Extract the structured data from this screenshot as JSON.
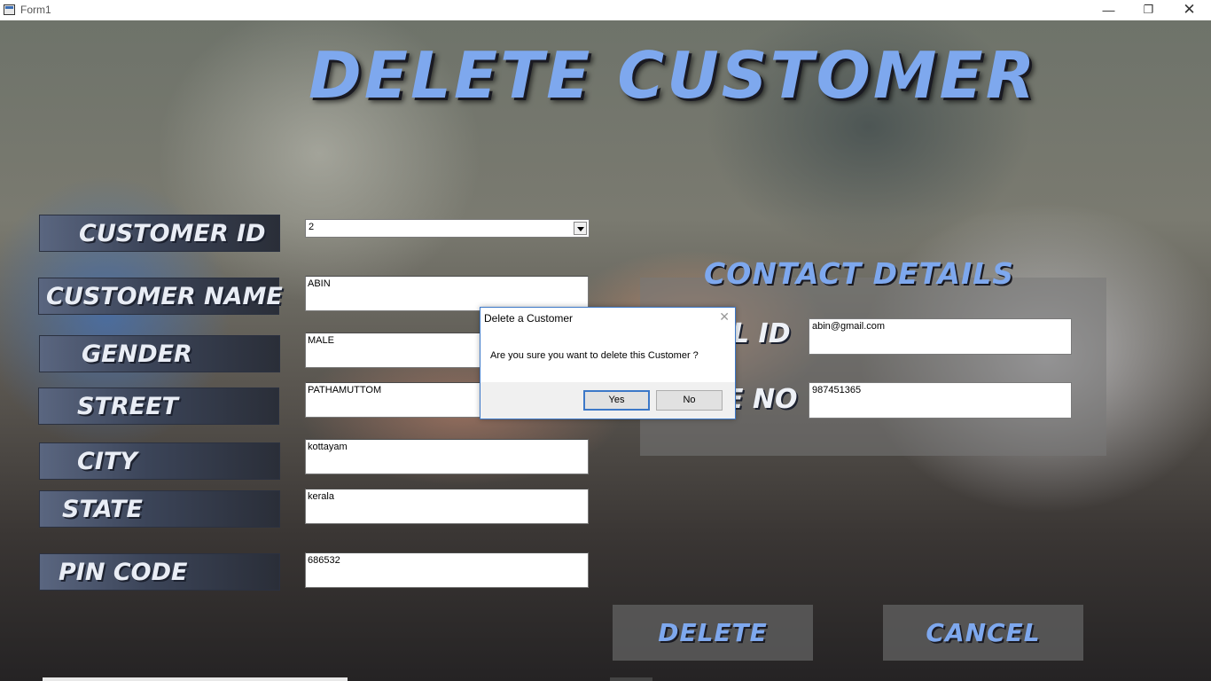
{
  "window": {
    "title": "Form1",
    "minimize": "—",
    "maximize": "❐",
    "close": "✕"
  },
  "form": {
    "heading": "DELETE CUSTOMER",
    "labels": {
      "customer_id": "CUSTOMER ID",
      "customer_name": "CUSTOMER NAME",
      "gender": "GENDER",
      "street": "STREET",
      "city": "CITY",
      "state": "STATE",
      "pin_code": "PIN CODE"
    },
    "values": {
      "customer_id": "2",
      "customer_name": "ABIN",
      "gender": "MALE",
      "street": "PATHAMUTTOM",
      "city": "kottayam",
      "state": "kerala",
      "pin_code": "686532"
    }
  },
  "contact": {
    "heading": "CONTACT DETAILS",
    "email_label_visible": "L ID",
    "phone_label_visible": "E NO",
    "email": "abin@gmail.com",
    "phone": "987451365"
  },
  "buttons": {
    "delete": "DELETE",
    "cancel": "CANCEL"
  },
  "dialog": {
    "title": "Delete a Customer",
    "message": "Are you sure you want to delete this Customer ?",
    "yes": "Yes",
    "no": "No",
    "close": "✕"
  },
  "colors": {
    "accent_text": "#7ea8ee",
    "dialog_border": "#3c78c8"
  }
}
